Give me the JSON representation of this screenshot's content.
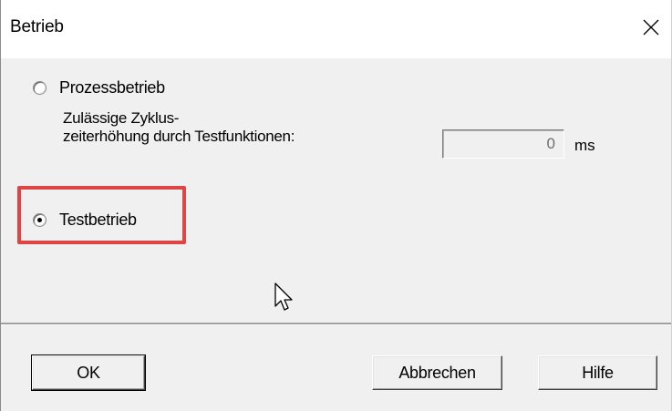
{
  "dialog": {
    "title": "Betrieb",
    "close_icon": "close-icon"
  },
  "options": {
    "process_mode": {
      "label": "Prozessbetrieb",
      "selected": false
    },
    "cycle_time": {
      "label_line1": "Zulässige Zyklus-",
      "label_line2": "zeiterhöhung durch Testfunktionen:",
      "value": "0",
      "unit": "ms"
    },
    "test_mode": {
      "label": "Testbetrieb",
      "selected": true
    }
  },
  "buttons": {
    "ok": "OK",
    "cancel": "Abbrechen",
    "help": "Hilfe"
  },
  "colors": {
    "highlight": "#e04545",
    "dialog_bg": "#f0f0f0",
    "titlebar_bg": "#ffffff"
  }
}
